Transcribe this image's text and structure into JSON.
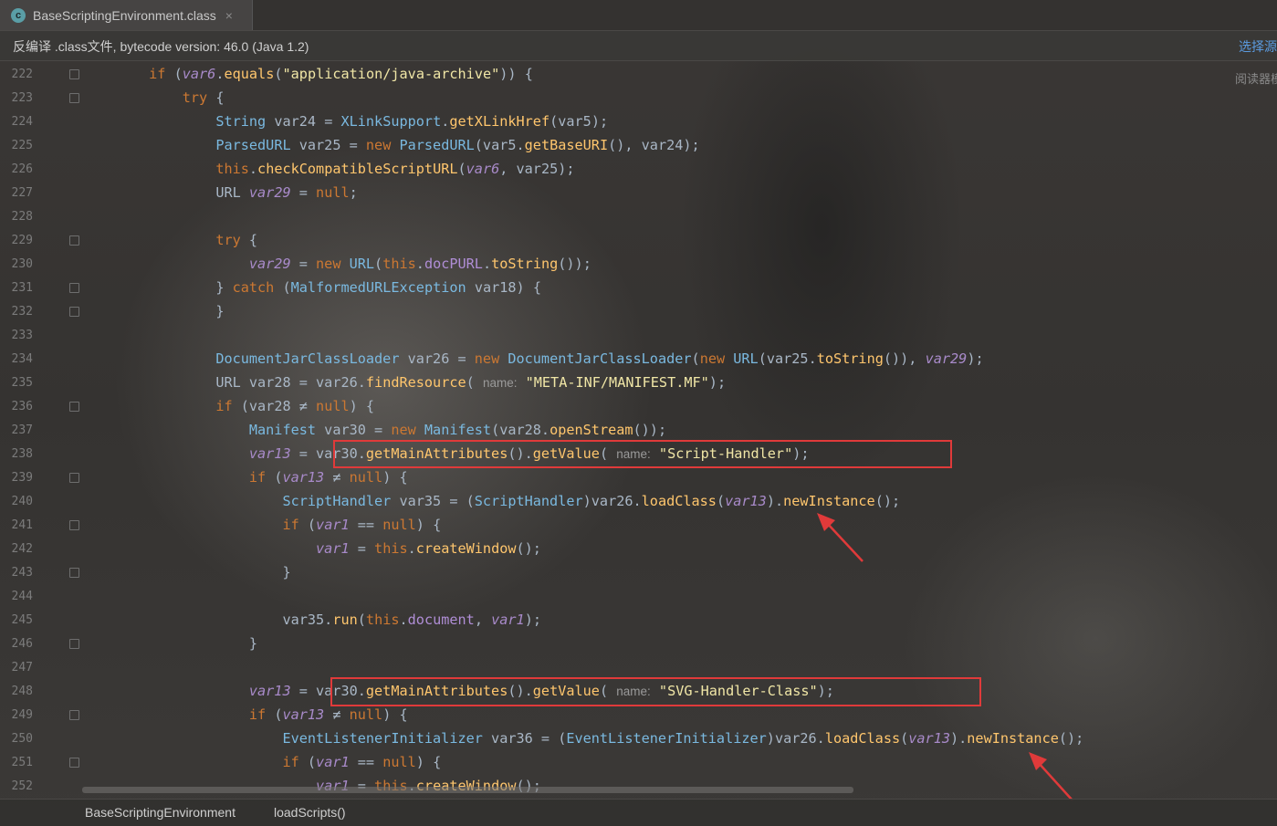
{
  "tab": {
    "title": "BaseScriptingEnvironment.class",
    "icon": "c",
    "close": "×"
  },
  "notice": {
    "text": "反编译 .class文件, bytecode version: 46.0 (Java 1.2)",
    "link": "选择源",
    "reader": "阅读器模"
  },
  "breadcrumb": {
    "class": "BaseScriptingEnvironment",
    "method": "loadScripts()"
  },
  "line_numbers": [
    "222",
    "223",
    "224",
    "225",
    "226",
    "227",
    "228",
    "229",
    "230",
    "231",
    "232",
    "233",
    "234",
    "235",
    "236",
    "237",
    "238",
    "239",
    "240",
    "241",
    "242",
    "243",
    "244",
    "245",
    "246",
    "247",
    "248",
    "249",
    "250",
    "251",
    "252"
  ],
  "code_lines": [
    {
      "indent": "        ",
      "tokens": [
        [
          "kw",
          "if "
        ],
        [
          "p",
          "("
        ],
        [
          "iv",
          "var6"
        ],
        [
          "p",
          "."
        ],
        [
          "fn",
          "equals"
        ],
        [
          "p",
          "("
        ],
        [
          "str",
          "\"application/java-archive\""
        ],
        [
          "p",
          ")) {"
        ]
      ]
    },
    {
      "indent": "            ",
      "tokens": [
        [
          "kw",
          "try "
        ],
        [
          "p",
          "{"
        ]
      ]
    },
    {
      "indent": "                ",
      "tokens": [
        [
          "cls",
          "String"
        ],
        [
          "p",
          " var24 = "
        ],
        [
          "cls",
          "XLinkSupport"
        ],
        [
          "p",
          "."
        ],
        [
          "fn",
          "getXLinkHref"
        ],
        [
          "p",
          "(var5);"
        ]
      ]
    },
    {
      "indent": "                ",
      "tokens": [
        [
          "cls",
          "ParsedURL"
        ],
        [
          "p",
          " var25 = "
        ],
        [
          "kw",
          "new "
        ],
        [
          "cls",
          "ParsedURL"
        ],
        [
          "p",
          "(var5."
        ],
        [
          "fn",
          "getBaseURI"
        ],
        [
          "p",
          "(), var24);"
        ]
      ]
    },
    {
      "indent": "                ",
      "tokens": [
        [
          "kw",
          "this"
        ],
        [
          "p",
          "."
        ],
        [
          "fn",
          "checkCompatibleScriptURL"
        ],
        [
          "p",
          "("
        ],
        [
          "iv",
          "var6"
        ],
        [
          "p",
          ", var25);"
        ]
      ]
    },
    {
      "indent": "                ",
      "tokens": [
        [
          "p",
          "URL "
        ],
        [
          "iv",
          "var29"
        ],
        [
          "p",
          " = "
        ],
        [
          "kw",
          "null"
        ],
        [
          "p",
          ";"
        ]
      ]
    },
    {
      "indent": "",
      "tokens": []
    },
    {
      "indent": "                ",
      "tokens": [
        [
          "kw",
          "try "
        ],
        [
          "p",
          "{"
        ]
      ]
    },
    {
      "indent": "                    ",
      "tokens": [
        [
          "iv",
          "var29"
        ],
        [
          "p",
          " = "
        ],
        [
          "kw",
          "new "
        ],
        [
          "cls",
          "URL"
        ],
        [
          "p",
          "("
        ],
        [
          "kw",
          "this"
        ],
        [
          "p",
          "."
        ],
        [
          "fld",
          "docPURL"
        ],
        [
          "p",
          "."
        ],
        [
          "fn",
          "toString"
        ],
        [
          "p",
          "());"
        ]
      ]
    },
    {
      "indent": "                ",
      "tokens": [
        [
          "p",
          "} "
        ],
        [
          "kw",
          "catch "
        ],
        [
          "p",
          "("
        ],
        [
          "cls",
          "MalformedURLException"
        ],
        [
          "p",
          " var18) {"
        ]
      ]
    },
    {
      "indent": "                ",
      "tokens": [
        [
          "p",
          "}"
        ]
      ]
    },
    {
      "indent": "",
      "tokens": []
    },
    {
      "indent": "                ",
      "tokens": [
        [
          "cls",
          "DocumentJarClassLoader"
        ],
        [
          "p",
          " var26 = "
        ],
        [
          "kw",
          "new "
        ],
        [
          "cls",
          "DocumentJarClassLoader"
        ],
        [
          "p",
          "("
        ],
        [
          "kw",
          "new "
        ],
        [
          "cls",
          "URL"
        ],
        [
          "p",
          "(var25."
        ],
        [
          "fn",
          "toString"
        ],
        [
          "p",
          "()), "
        ],
        [
          "iv",
          "var29"
        ],
        [
          "p",
          ");"
        ]
      ]
    },
    {
      "indent": "                ",
      "tokens": [
        [
          "p",
          "URL var28 = var26."
        ],
        [
          "fn",
          "findResource"
        ],
        [
          "p",
          "( "
        ],
        [
          "hint",
          "name:"
        ],
        [
          "p",
          " "
        ],
        [
          "str",
          "\"META-INF/MANIFEST.MF\""
        ],
        [
          "p",
          ");"
        ]
      ]
    },
    {
      "indent": "                ",
      "tokens": [
        [
          "kw",
          "if "
        ],
        [
          "p",
          "(var28 ≠ "
        ],
        [
          "kw",
          "null"
        ],
        [
          "p",
          ") {"
        ]
      ]
    },
    {
      "indent": "                    ",
      "tokens": [
        [
          "cls",
          "Manifest"
        ],
        [
          "p",
          " var30 = "
        ],
        [
          "kw",
          "new "
        ],
        [
          "cls",
          "Manifest"
        ],
        [
          "p",
          "(var28."
        ],
        [
          "fn",
          "openStream"
        ],
        [
          "p",
          "());"
        ]
      ]
    },
    {
      "indent": "                    ",
      "tokens": [
        [
          "iv",
          "var13"
        ],
        [
          "p",
          " = var30."
        ],
        [
          "fn",
          "getMainAttributes"
        ],
        [
          "p",
          "()."
        ],
        [
          "fn",
          "getValue"
        ],
        [
          "p",
          "( "
        ],
        [
          "hint",
          "name:"
        ],
        [
          "p",
          " "
        ],
        [
          "str",
          "\"Script-Handler\""
        ],
        [
          "p",
          ");"
        ]
      ]
    },
    {
      "indent": "                    ",
      "tokens": [
        [
          "kw",
          "if "
        ],
        [
          "p",
          "("
        ],
        [
          "iv",
          "var13"
        ],
        [
          "p",
          " ≠ "
        ],
        [
          "kw",
          "null"
        ],
        [
          "p",
          ") {"
        ]
      ]
    },
    {
      "indent": "                        ",
      "tokens": [
        [
          "cls",
          "ScriptHandler"
        ],
        [
          "p",
          " var35 = ("
        ],
        [
          "cls",
          "ScriptHandler"
        ],
        [
          "p",
          ")var26."
        ],
        [
          "fn",
          "loadClass"
        ],
        [
          "p",
          "("
        ],
        [
          "iv",
          "var13"
        ],
        [
          "p",
          ")."
        ],
        [
          "fn",
          "newInstance"
        ],
        [
          "p",
          "();"
        ]
      ]
    },
    {
      "indent": "                        ",
      "tokens": [
        [
          "kw",
          "if "
        ],
        [
          "p",
          "("
        ],
        [
          "iv",
          "var1"
        ],
        [
          "p",
          " == "
        ],
        [
          "kw",
          "null"
        ],
        [
          "p",
          ") {"
        ]
      ]
    },
    {
      "indent": "                            ",
      "tokens": [
        [
          "iv",
          "var1"
        ],
        [
          "p",
          " = "
        ],
        [
          "kw",
          "this"
        ],
        [
          "p",
          "."
        ],
        [
          "fn",
          "createWindow"
        ],
        [
          "p",
          "();"
        ]
      ]
    },
    {
      "indent": "                        ",
      "tokens": [
        [
          "p",
          "}"
        ]
      ]
    },
    {
      "indent": "",
      "tokens": []
    },
    {
      "indent": "                        ",
      "tokens": [
        [
          "p",
          "var35."
        ],
        [
          "fn",
          "run"
        ],
        [
          "p",
          "("
        ],
        [
          "kw",
          "this"
        ],
        [
          "p",
          "."
        ],
        [
          "fld",
          "document"
        ],
        [
          "p",
          ", "
        ],
        [
          "iv",
          "var1"
        ],
        [
          "p",
          ");"
        ]
      ]
    },
    {
      "indent": "                    ",
      "tokens": [
        [
          "p",
          "}"
        ]
      ]
    },
    {
      "indent": "",
      "tokens": []
    },
    {
      "indent": "                    ",
      "tokens": [
        [
          "iv",
          "var13"
        ],
        [
          "p",
          " = var30."
        ],
        [
          "fn",
          "getMainAttributes"
        ],
        [
          "p",
          "()."
        ],
        [
          "fn",
          "getValue"
        ],
        [
          "p",
          "( "
        ],
        [
          "hint",
          "name:"
        ],
        [
          "p",
          " "
        ],
        [
          "str",
          "\"SVG-Handler-Class\""
        ],
        [
          "p",
          ");"
        ]
      ]
    },
    {
      "indent": "                    ",
      "tokens": [
        [
          "kw",
          "if "
        ],
        [
          "p",
          "("
        ],
        [
          "iv",
          "var13"
        ],
        [
          "p",
          " ≠ "
        ],
        [
          "kw",
          "null"
        ],
        [
          "p",
          ") {"
        ]
      ]
    },
    {
      "indent": "                        ",
      "tokens": [
        [
          "cls",
          "EventListenerInitializer"
        ],
        [
          "p",
          " var36 = ("
        ],
        [
          "cls",
          "EventListenerInitializer"
        ],
        [
          "p",
          ")var26."
        ],
        [
          "fn",
          "loadClass"
        ],
        [
          "p",
          "("
        ],
        [
          "iv",
          "var13"
        ],
        [
          "p",
          ")."
        ],
        [
          "fn",
          "newInstance"
        ],
        [
          "p",
          "();"
        ]
      ]
    },
    {
      "indent": "                        ",
      "tokens": [
        [
          "kw",
          "if "
        ],
        [
          "p",
          "("
        ],
        [
          "iv",
          "var1"
        ],
        [
          "p",
          " == "
        ],
        [
          "kw",
          "null"
        ],
        [
          "p",
          ") {"
        ]
      ]
    },
    {
      "indent": "                            ",
      "tokens": [
        [
          "iv",
          "var1"
        ],
        [
          "p",
          " = "
        ],
        [
          "kw",
          "this"
        ],
        [
          "p",
          "."
        ],
        [
          "fn",
          "createWindow"
        ],
        [
          "p",
          "();"
        ]
      ]
    }
  ],
  "colors": {
    "highlight_box": "#e03a3a",
    "keyword": "#cc7832",
    "string": "#f0e6a6",
    "method": "#ffc66d",
    "type": "#7ab9e0"
  }
}
